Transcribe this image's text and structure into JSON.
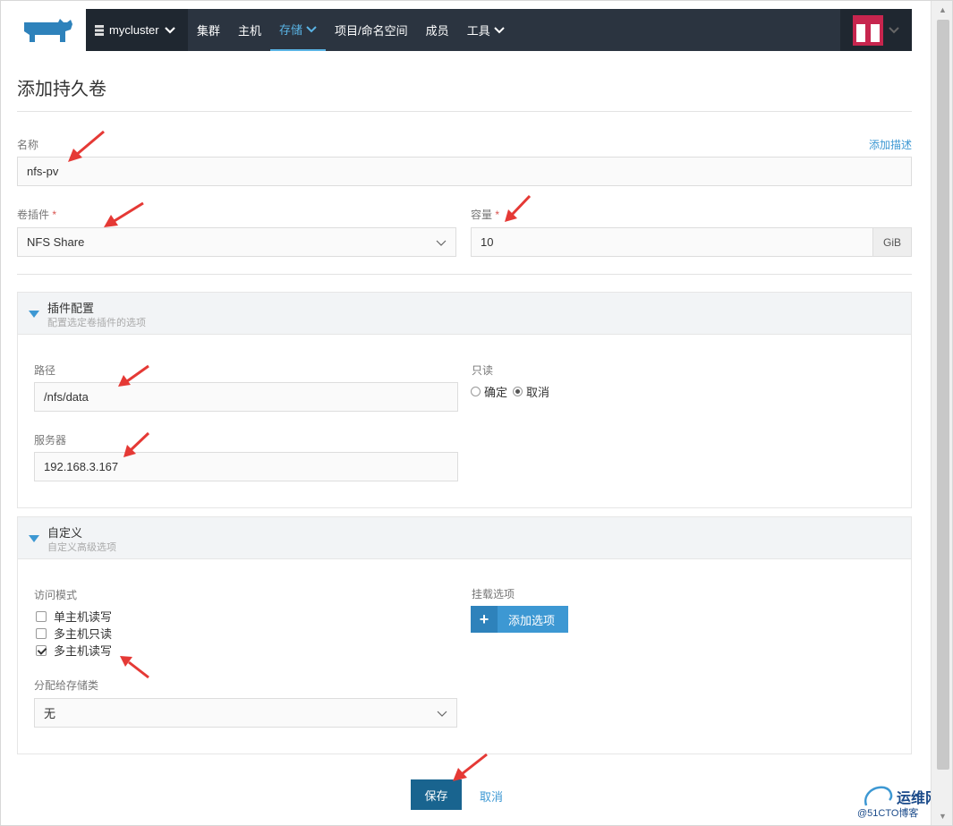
{
  "header": {
    "cluster_name": "mycluster",
    "nav": [
      {
        "label": "集群"
      },
      {
        "label": "主机"
      },
      {
        "label": "存储"
      },
      {
        "label": "项目/命名空间"
      },
      {
        "label": "成员"
      },
      {
        "label": "工具"
      }
    ],
    "active_nav": "存储"
  },
  "page": {
    "title": "添加持久卷",
    "add_description_link": "添加描述"
  },
  "form": {
    "name_label": "名称",
    "name_value": "nfs-pv",
    "plugin_label": "卷插件",
    "plugin_value": "NFS Share",
    "capacity_label": "容量",
    "capacity_value": "10",
    "capacity_unit": "GiB",
    "required_mark": "*"
  },
  "plugin_panel": {
    "title": "插件配置",
    "subtitle": "配置选定卷插件的选项",
    "path_label": "路径",
    "path_value": "/nfs/data",
    "server_label": "服务器",
    "server_value": "192.168.3.167",
    "readonly_label": "只读",
    "readonly_yes": "确定",
    "readonly_no": "取消",
    "readonly_selected": "取消"
  },
  "custom_panel": {
    "title": "自定义",
    "subtitle": "自定义高级选项",
    "access_mode_label": "访问模式",
    "access_modes": [
      {
        "label": "单主机读写",
        "checked": false
      },
      {
        "label": "多主机只读",
        "checked": false
      },
      {
        "label": "多主机读写",
        "checked": true
      }
    ],
    "storage_class_label": "分配给存储类",
    "storage_class_value": "无",
    "mount_options_label": "挂载选项",
    "add_option_button": "添加选项"
  },
  "footer": {
    "save_button": "保存",
    "cancel_link": "取消"
  },
  "watermark": {
    "line1": "运维网",
    "line2": "@51CTO博客"
  },
  "colors": {
    "navbar": "#2b3440",
    "accent": "#3d98d3",
    "save_button": "#19648f",
    "arrow": "#e53935",
    "avatar": "#c7254e"
  }
}
